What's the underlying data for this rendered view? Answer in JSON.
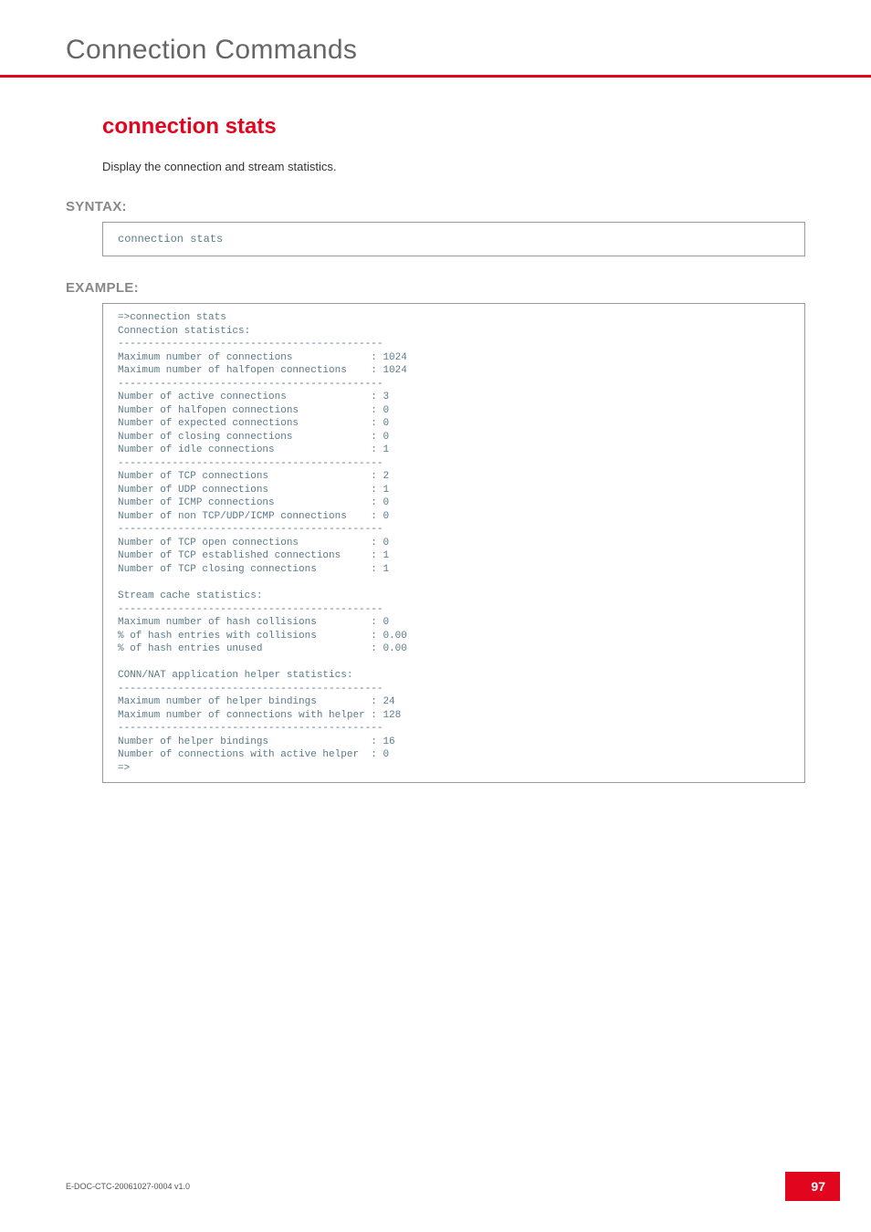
{
  "header": {
    "title": "Connection Commands"
  },
  "main": {
    "heading": "connection stats",
    "description": "Display the connection and stream statistics.",
    "syntax_label": "SYNTAX:",
    "syntax_code": "connection stats",
    "example_label": "EXAMPLE:",
    "example_code": "=>connection stats\nConnection statistics:\n--------------------------------------------\nMaximum number of connections             : 1024\nMaximum number of halfopen connections    : 1024\n--------------------------------------------\nNumber of active connections              : 3\nNumber of halfopen connections            : 0\nNumber of expected connections            : 0\nNumber of closing connections             : 0\nNumber of idle connections                : 1\n--------------------------------------------\nNumber of TCP connections                 : 2\nNumber of UDP connections                 : 1\nNumber of ICMP connections                : 0\nNumber of non TCP/UDP/ICMP connections    : 0\n--------------------------------------------\nNumber of TCP open connections            : 0\nNumber of TCP established connections     : 1\nNumber of TCP closing connections         : 1\n\nStream cache statistics:\n--------------------------------------------\nMaximum number of hash collisions         : 0\n% of hash entries with collisions         : 0.00\n% of hash entries unused                  : 0.00\n\nCONN/NAT application helper statistics:\n--------------------------------------------\nMaximum number of helper bindings         : 24\nMaximum number of connections with helper : 128\n--------------------------------------------\nNumber of helper bindings                 : 16\nNumber of connections with active helper  : 0\n=>"
  },
  "footer": {
    "doc_id": "E-DOC-CTC-20061027-0004 v1.0",
    "page_number": "97"
  }
}
